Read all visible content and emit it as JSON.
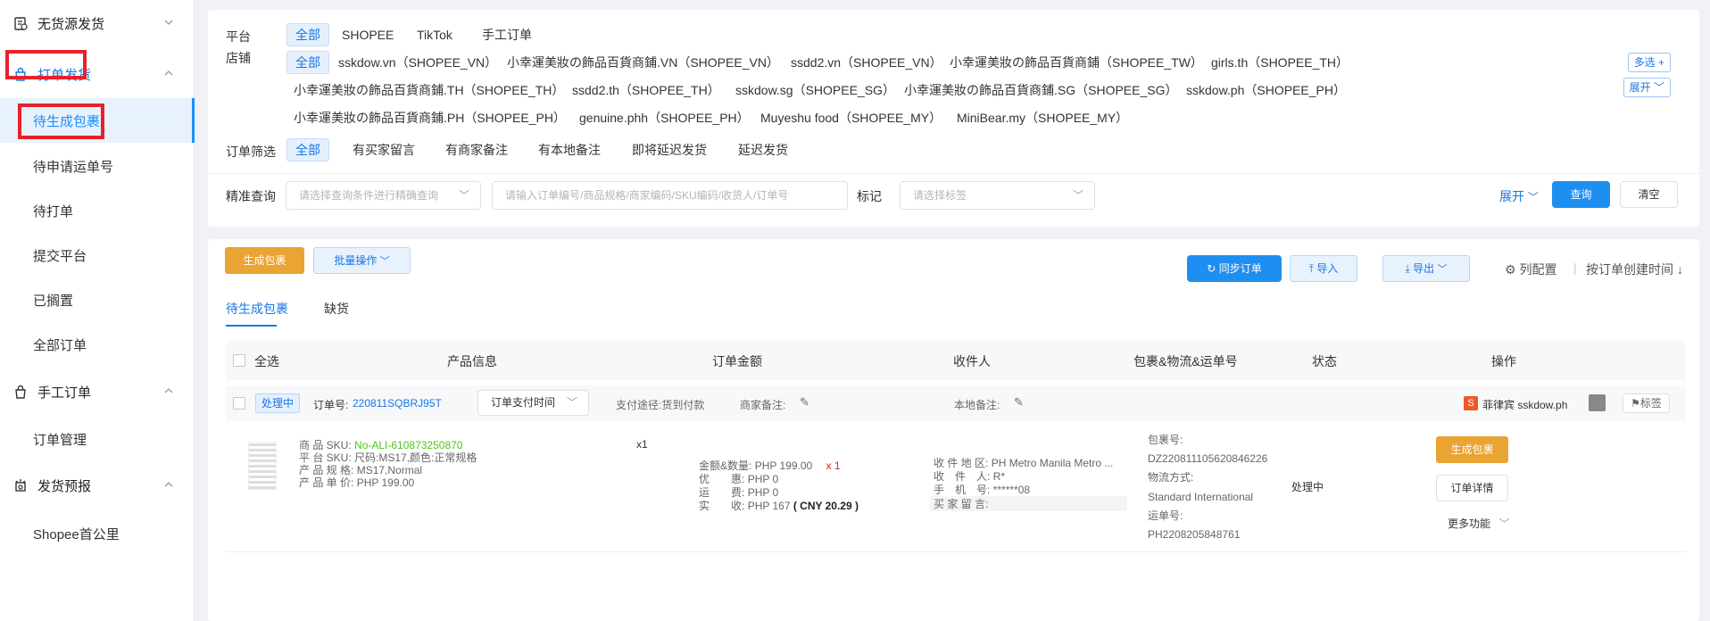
{
  "sidebar": {
    "groups": [
      {
        "label": "无货源发货",
        "icon": "clipboard-icon"
      },
      {
        "label": "打单发货",
        "icon": "bag-icon"
      },
      {
        "label": "手工订单",
        "icon": "bag-icon"
      },
      {
        "label": "发货预报",
        "icon": "alarm-icon"
      }
    ],
    "items": [
      "待生成包裹",
      "待申请运单号",
      "待打单",
      "提交平台",
      "已搁置",
      "全部订单",
      "订单管理",
      "Shopee首公里"
    ]
  },
  "filters": {
    "platform_label": "平台",
    "platforms": [
      "全部",
      "SHOPEE",
      "TikTok",
      "手工订单"
    ],
    "store_label": "店铺",
    "stores_row1": [
      "全部",
      "sskdow.vn（SHOPEE_VN）",
      "小幸運美妝の飾品百貨商鋪.VN（SHOPEE_VN）",
      "ssdd2.vn（SHOPEE_VN）",
      "小幸運美妝の飾品百貨商鋪（SHOPEE_TW）",
      "girls.th（SHOPEE_TH）"
    ],
    "stores_row2": [
      "小幸運美妝の飾品百貨商鋪.TH（SHOPEE_TH）",
      "ssdd2.th（SHOPEE_TH）",
      "sskdow.sg（SHOPEE_SG）",
      "小幸運美妝の飾品百貨商鋪.SG（SHOPEE_SG）",
      "sskdow.ph（SHOPEE_PH）"
    ],
    "stores_row3": [
      "小幸運美妝の飾品百貨商鋪.PH（SHOPEE_PH）",
      "genuine.phh（SHOPEE_PH）",
      "Muyeshu food（SHOPEE_MY）",
      "MiniBear.my（SHOPEE_MY）"
    ],
    "multi_select": "多选 +",
    "expand": "展开 ﹀",
    "order_filter_label": "订单筛选",
    "order_filters": [
      "全部",
      "有买家留言",
      "有商家备注",
      "有本地备注",
      "即将延迟发货",
      "延迟发货"
    ],
    "precise_label": "精准查询",
    "precise_select_placeholder": "请选择查询条件进行精确查询",
    "precise_input_placeholder": "请输入订单编号/商品规格/商家编码/SKU编码/收货人/订单号",
    "mark_label": "标记",
    "mark_placeholder": "请选择标签",
    "expand_link": "展开",
    "query_btn": "查询",
    "clear_btn": "清空"
  },
  "toolbar": {
    "generate": "生成包裹",
    "batch": "批量操作",
    "sync": "同步订单",
    "import": "导入",
    "export": "导出",
    "columns": "列配置",
    "sort": "按订单创建时间"
  },
  "tabs": [
    "待生成包裹",
    "缺货"
  ],
  "table": {
    "headers": [
      "全选",
      "产品信息",
      "订单金额",
      "收件人",
      "包裹&物流&运单号",
      "状态",
      "操作"
    ]
  },
  "order": {
    "status_tag": "处理中",
    "order_no_label": "订单号:",
    "order_no": "220811SQBRJ95T",
    "pay_time_select": "订单支付时间",
    "pay_method": "支付途径:货到付款",
    "merchant_note": "商家备注:",
    "local_note": "本地备注:",
    "shop_name": "菲律宾 sskdow.ph",
    "tag_btn": "标签",
    "product": {
      "sku_label": "商 品 SKU:",
      "sku": "No-ALI-610873250870",
      "plat_sku_label": "平 台 SKU:",
      "plat_sku": "尺码:MS17,颜色:正常规格",
      "spec_label": "产 品 规 格:",
      "spec": "MS17,Normal",
      "price_label": "产 品 单 价:",
      "price": "PHP 199.00",
      "qty": "x1"
    },
    "amount": {
      "amount_qty_label": "金额&数量:",
      "amount_qty": "PHP 199.00",
      "qty": "x 1",
      "discount_label": "优　　惠:",
      "discount": "PHP 0",
      "shipping_label": "运　　费:",
      "shipping": "PHP 0",
      "received_label": "实　　收:",
      "received": "PHP 167",
      "cny": "( CNY  20.29 )"
    },
    "recipient": {
      "area_label": "收 件 地 区:",
      "area": "PH Metro Manila Metro ...",
      "name_label": "收　件　人:",
      "name": "R*",
      "phone_label": "手　机　号:",
      "phone": "******08",
      "msg_label": "买 家 留 言:"
    },
    "logistics": {
      "pkg_label": "包裹号:",
      "pkg": "DZ220811105620846226",
      "method_label": "物流方式:",
      "method": "Standard International",
      "waybill_label": "运单号:",
      "waybill": "PH2208205848761"
    },
    "state": "处理中",
    "actions": {
      "generate": "生成包裹",
      "detail": "订单详情",
      "more": "更多功能"
    }
  }
}
